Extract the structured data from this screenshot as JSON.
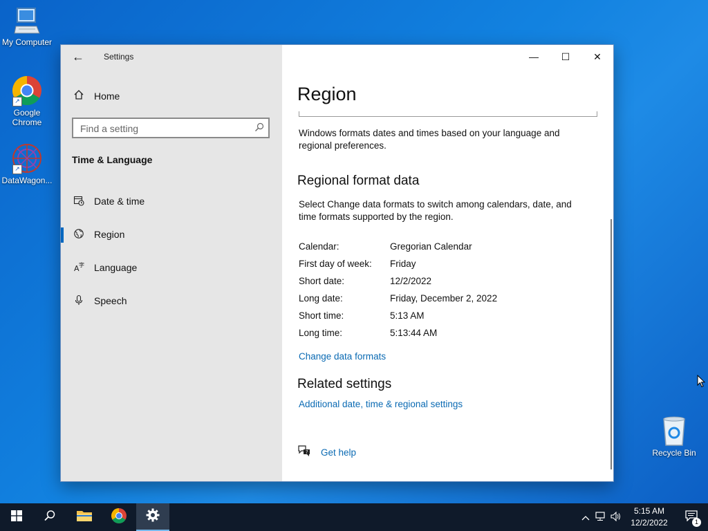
{
  "desktop": {
    "icons": [
      {
        "label": "My Computer"
      },
      {
        "label": "Google Chrome"
      },
      {
        "label": "DataWagon..."
      },
      {
        "label": "Recycle Bin"
      }
    ]
  },
  "window": {
    "app_title": "Settings",
    "controls": {
      "minimize": "—",
      "maximize": "☐",
      "close": "✕"
    }
  },
  "sidebar": {
    "home_label": "Home",
    "search_placeholder": "Find a setting",
    "section": "Time & Language",
    "items": [
      {
        "label": "Date & time",
        "icon": "calendar-clock-icon"
      },
      {
        "label": "Region",
        "icon": "globe-icon",
        "active": true
      },
      {
        "label": "Language",
        "icon": "language-icon"
      },
      {
        "label": "Speech",
        "icon": "microphone-icon"
      }
    ]
  },
  "main": {
    "title": "Region",
    "intro": "Windows formats dates and times based on your language and regional preferences.",
    "regional_heading": "Regional format data",
    "regional_desc": "Select Change data formats to switch among calendars, date, and time formats supported by the region.",
    "formats": [
      {
        "key": "Calendar:",
        "value": "Gregorian Calendar"
      },
      {
        "key": "First day of week:",
        "value": "Friday"
      },
      {
        "key": "Short date:",
        "value": "12/2/2022"
      },
      {
        "key": "Long date:",
        "value": "Friday, December 2, 2022"
      },
      {
        "key": "Short time:",
        "value": "5:13 AM"
      },
      {
        "key": "Long time:",
        "value": "5:13:44 AM"
      }
    ],
    "change_link": "Change data formats",
    "related_heading": "Related settings",
    "related_link": "Additional date, time & regional settings",
    "help_link": "Get help"
  },
  "taskbar": {
    "time": "5:15 AM",
    "date": "12/2/2022",
    "notification_count": "1"
  },
  "colors": {
    "accent": "#0067c0",
    "link": "#0a6ab3",
    "taskbar": "#0f1a2a"
  }
}
